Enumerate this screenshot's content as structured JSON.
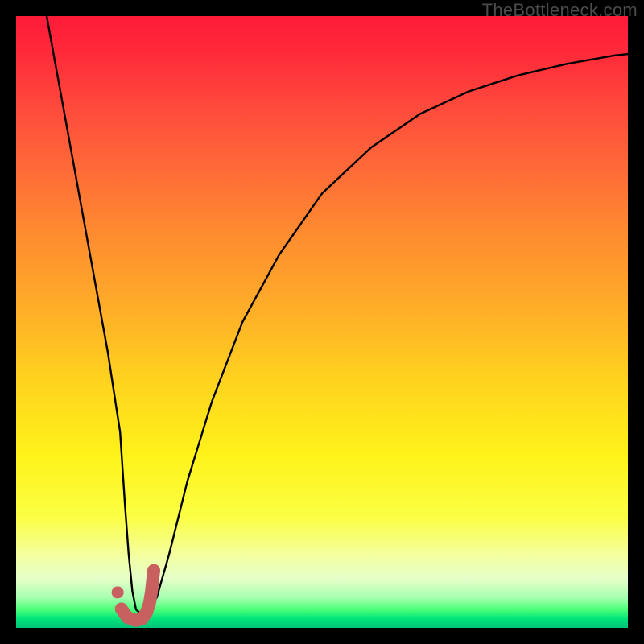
{
  "watermark": "TheBottleneck.com",
  "colors": {
    "frame": "#000000",
    "curve": "#000000",
    "marker_stroke": "#c86060",
    "marker_dot": "#c86060",
    "gradient_top": "#ff1a3a",
    "gradient_bottom": "#00c47a"
  },
  "chart_data": {
    "type": "line",
    "title": "",
    "xlabel": "",
    "ylabel": "",
    "xlim": [
      0,
      100
    ],
    "ylim": [
      0,
      100
    ],
    "grid": false,
    "series": [
      {
        "name": "bottleneck-curve",
        "x": [
          5,
          7,
          9,
          11,
          13,
          15,
          17,
          17.8,
          18.4,
          19,
          19.6,
          20.5,
          21.5,
          23,
          25,
          28,
          32,
          37,
          43,
          50,
          58,
          66,
          74,
          82,
          90,
          98,
          100
        ],
        "y": [
          100,
          89,
          78,
          67,
          56,
          45,
          32,
          20,
          12,
          6,
          3,
          2.2,
          2.5,
          5,
          12,
          24,
          37,
          50,
          61,
          71,
          78.5,
          84,
          87.7,
          90.3,
          92.2,
          93.6,
          93.8
        ]
      }
    ],
    "annotations": [
      {
        "name": "optimal-J-marker",
        "type": "path",
        "x": [
          17.2,
          18.2,
          19.6,
          20.6,
          21.3,
          21.8,
          22.1,
          22.3,
          22.5
        ],
        "y": [
          3.1,
          1.7,
          1.2,
          1.5,
          2.5,
          4.0,
          5.8,
          7.6,
          9.4
        ]
      },
      {
        "name": "optimal-dot",
        "type": "point",
        "x": 16.6,
        "y": 5.8
      }
    ]
  }
}
